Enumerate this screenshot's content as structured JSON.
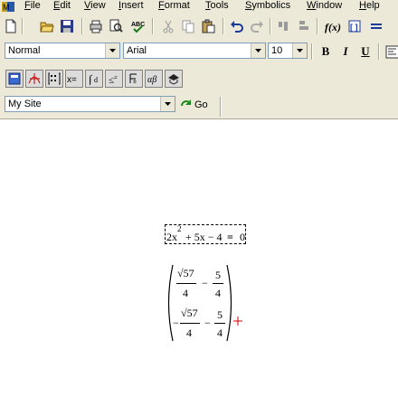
{
  "menu": {
    "items": [
      "File",
      "Edit",
      "View",
      "Insert",
      "Format",
      "Tools",
      "Symbolics",
      "Window",
      "Help"
    ]
  },
  "toolbar_standard": {
    "icons": [
      "new-icon",
      "open-icon",
      "save-icon",
      "print-icon",
      "print-preview-icon",
      "spell-check-icon",
      "cut-icon",
      "copy-icon",
      "paste-icon",
      "undo-icon",
      "redo-icon",
      "align-across-icon",
      "align-down-icon",
      "insert-function-icon",
      "insert-unit-icon",
      "calculate-icon"
    ]
  },
  "toolbar_formatting": {
    "style": "Normal",
    "font": "Arial",
    "size": "10",
    "bold": "B",
    "italic": "I",
    "underline": "U"
  },
  "toolbar_math": {
    "icons": [
      "calculator-toolbar-icon",
      "graph-toolbar-icon",
      "matrix-toolbar-icon",
      "evaluation-toolbar-icon",
      "calculus-toolbar-icon",
      "boolean-toolbar-icon",
      "programming-toolbar-icon",
      "greek-toolbar-icon",
      "symbolic-toolbar-icon"
    ]
  },
  "toolbar_web": {
    "site": "My Site",
    "go_label": "Go"
  },
  "worksheet": {
    "equation": {
      "lhs_coef": "2x",
      "exponent": "2",
      "rest": "+ 5x − 4",
      "equals": "=",
      "rhs": "0"
    },
    "result": {
      "r1_num": "√57",
      "r1_den": "4",
      "r1_op": "−",
      "r1_num2": "5",
      "r1_den2": "4",
      "r2_sign": "−",
      "r2_num": "√57",
      "r2_den": "4",
      "r2_op": "−",
      "r2_num2": "5",
      "r2_den2": "4"
    }
  }
}
